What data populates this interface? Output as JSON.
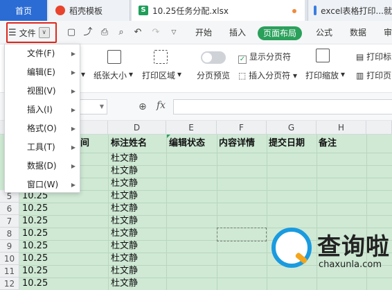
{
  "tabs": {
    "home": "首页",
    "template": "稻壳模板",
    "file": "10.25任务分配.xlsx",
    "web": "excel表格打印...就"
  },
  "menubar": {
    "file_label": "文件",
    "ribbon_tabs": [
      "开始",
      "插入",
      "页面布局",
      "公式",
      "数据",
      "审"
    ],
    "active_tab": "页面布局"
  },
  "toolbar": {
    "paper_size": "纸张大小",
    "print_area": "打印区域",
    "show_page_break": "显示分页符",
    "page_preview": "分页预览",
    "insert_page_break": "插入分页符",
    "print_scale": "打印缩放",
    "print_title": "打印标",
    "print_page": "打印页"
  },
  "formula_bar": {
    "fx": "fx"
  },
  "grid": {
    "columns": [
      "D",
      "E",
      "F",
      "G",
      "H"
    ],
    "header_row": [
      "间",
      "标注姓名",
      "编辑状态",
      "内容详情",
      "提交日期",
      "备注"
    ],
    "row_numbers": [
      "5",
      "6",
      "7",
      "8",
      "9",
      "10",
      "11",
      "12"
    ],
    "name_values": [
      "杜文静",
      "杜文静",
      "杜文静",
      "杜文静",
      "杜文静",
      "杜文静",
      "杜文静",
      "杜文静",
      "杜文静",
      "杜文静",
      "杜文静",
      "杜文静"
    ],
    "date_values": [
      "10.25",
      "10.25",
      "10.25",
      "10.25",
      "10.25",
      "10.25",
      "10.25",
      "10.25"
    ]
  },
  "file_menu": {
    "items": [
      "文件(F)",
      "编辑(E)",
      "视图(V)",
      "插入(I)",
      "格式(O)",
      "工具(T)",
      "数据(D)",
      "窗口(W)"
    ]
  },
  "watermark": {
    "text": "查询啦",
    "url": "chaxunla.com"
  },
  "colors": {
    "active_tab": "#2aa05b",
    "home_tab": "#2b6cd4",
    "highlight": "#e0261b",
    "sheet_bg": "#cfe9d4"
  }
}
